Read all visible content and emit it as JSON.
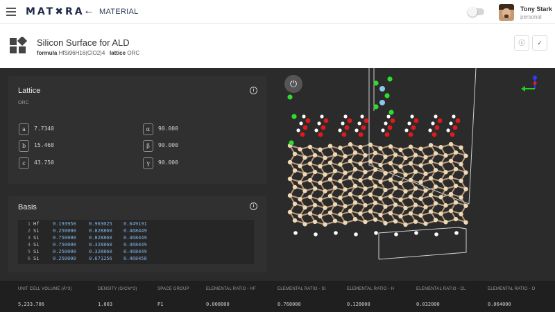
{
  "topbar": {
    "logo": "MAT✖RA",
    "section": "MATERIAL",
    "user": {
      "name": "Tony Stark",
      "role": "personal"
    }
  },
  "material": {
    "title": "Silicon Surface for ALD",
    "formula_label": "formula",
    "formula": "HfSi96H16(ClO2)4",
    "lattice_label": "lattice",
    "lattice": "ORC",
    "actions": {
      "info": "ⓘ",
      "confirm": "✓"
    }
  },
  "lattice_card": {
    "title": "Lattice",
    "type": "ORC",
    "params": [
      {
        "symbol": "a",
        "value": "7.7340"
      },
      {
        "symbol": "b",
        "value": "15.468"
      },
      {
        "symbol": "c",
        "value": "43.750"
      },
      {
        "symbol": "α",
        "value": "90.000"
      },
      {
        "symbol": "β",
        "value": "90.000"
      },
      {
        "symbol": "γ",
        "value": "90.000"
      }
    ]
  },
  "basis_card": {
    "title": "Basis",
    "rows": [
      {
        "n": "1",
        "el": "Hf",
        "x": "0.193950",
        "y": "0.903025",
        "z": "0.649191"
      },
      {
        "n": "2",
        "el": "Si",
        "x": "0.250000",
        "y": "0.828860",
        "z": "0.468449"
      },
      {
        "n": "3",
        "el": "Si",
        "x": "0.750000",
        "y": "0.828860",
        "z": "0.468449"
      },
      {
        "n": "4",
        "el": "Si",
        "x": "0.750000",
        "y": "0.328860",
        "z": "0.468449"
      },
      {
        "n": "5",
        "el": "Si",
        "x": "0.250000",
        "y": "0.328860",
        "z": "0.468449"
      },
      {
        "n": "6",
        "el": "Si",
        "x": "0.250000",
        "y": "0.671256",
        "z": "0.468458"
      }
    ]
  },
  "viewer": {
    "power_icon": "⏻"
  },
  "properties": [
    {
      "label": "UNIT CELL VOLUME (Å^3)",
      "value": "5,233.706"
    },
    {
      "label": "DENSITY (G/CM^3)",
      "value": "1.003"
    },
    {
      "label": "SPACE GROUP",
      "value": "P1"
    },
    {
      "label": "ELEMENTAL RATIO - HF",
      "value": "0.008000"
    },
    {
      "label": "ELEMENTAL RATIO - SI",
      "value": "0.768000"
    },
    {
      "label": "ELEMENTAL RATIO - H",
      "value": "0.128000"
    },
    {
      "label": "ELEMENTAL RATIO - CL",
      "value": "0.032000"
    },
    {
      "label": "ELEMENTAL RATIO - O",
      "value": "0.064000"
    }
  ]
}
